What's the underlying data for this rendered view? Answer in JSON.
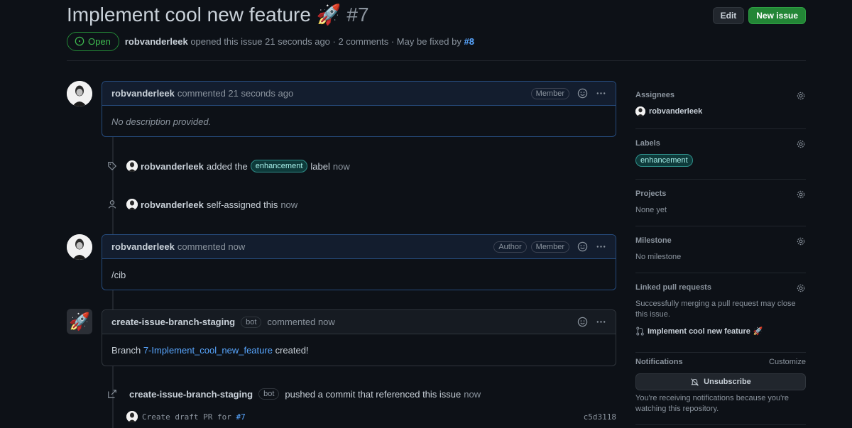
{
  "issue": {
    "title": "Implement cool new feature",
    "emoji": "🚀",
    "number": "#7",
    "state": "Open",
    "author": "robvanderleek",
    "opened_text": "opened this issue 21 seconds ago · 2 comments · May be fixed by",
    "fixed_by": "#8"
  },
  "header": {
    "edit_label": "Edit",
    "new_issue_label": "New issue"
  },
  "timeline": {
    "c1": {
      "author": "robvanderleek",
      "meta": "commented 21 seconds ago",
      "badge": "Member",
      "body": "No description provided."
    },
    "e1": {
      "author": "robvanderleek",
      "text": "added the",
      "label": "enhancement",
      "tail": "label",
      "time": "now"
    },
    "e2": {
      "author": "robvanderleek",
      "text": "self-assigned this",
      "time": "now"
    },
    "c2": {
      "author": "robvanderleek",
      "meta": "commented now",
      "badge1": "Author",
      "badge2": "Member",
      "body": "/cib"
    },
    "c3": {
      "author": "create-issue-branch-staging",
      "bot": "bot",
      "meta": "commented now",
      "body_prefix": "Branch",
      "branch": "7-Implement_cool_new_feature",
      "body_suffix": "created!"
    },
    "e3": {
      "author": "create-issue-branch-staging",
      "bot": "bot",
      "text": "pushed a commit that referenced this issue",
      "time": "now"
    },
    "commit": {
      "message": "Create draft PR for",
      "ref": "#7",
      "sha": "c5d3118"
    }
  },
  "sidebar": {
    "assignees": {
      "title": "Assignees",
      "value": "robvanderleek"
    },
    "labels": {
      "title": "Labels",
      "value": "enhancement"
    },
    "projects": {
      "title": "Projects",
      "value": "None yet"
    },
    "milestone": {
      "title": "Milestone",
      "value": "No milestone"
    },
    "linked": {
      "title": "Linked pull requests",
      "description": "Successfully merging a pull request may close this issue.",
      "pr_title": "Implement cool new feature",
      "pr_emoji": "🚀"
    },
    "notifications": {
      "title": "Notifications",
      "customize": "Customize",
      "unsubscribe": "Unsubscribe",
      "reason": "You're receiving notifications because you're watching this repository."
    }
  },
  "colors": {
    "accent": "#58a6ff",
    "open": "#3fb950",
    "new_issue_btn": "#238636",
    "background": "#0d1117"
  }
}
